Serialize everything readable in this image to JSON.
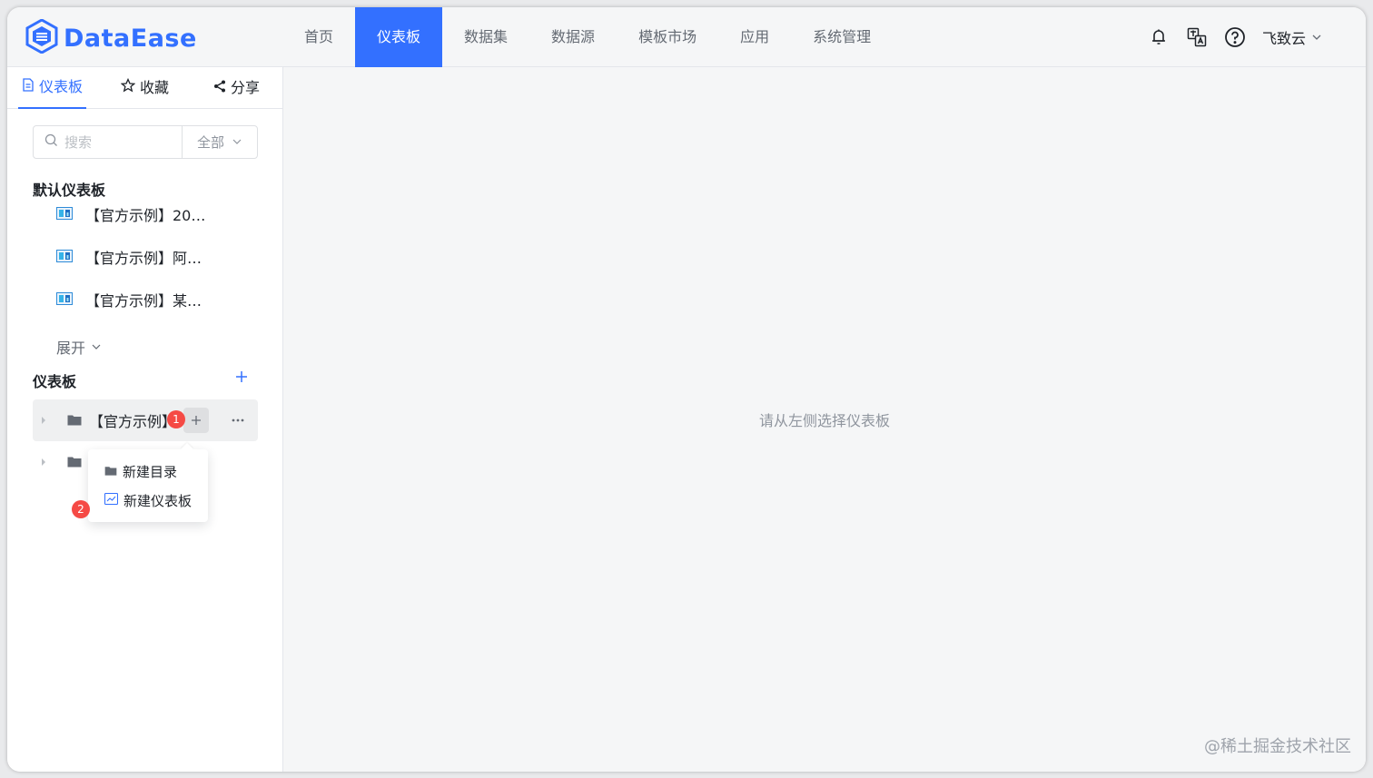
{
  "app": {
    "logo_text": "DataEase",
    "brand_color": "#3370ff"
  },
  "nav": {
    "items": [
      "首页",
      "仪表板",
      "数据集",
      "数据源",
      "模板市场",
      "应用",
      "系统管理"
    ],
    "active_index": 1
  },
  "header_right": {
    "user_name": "飞致云",
    "icons": [
      "bell-icon",
      "translate-icon",
      "help-icon"
    ]
  },
  "sidebar": {
    "tabs": [
      {
        "label": "仪表板",
        "icon": "document-icon",
        "active": true
      },
      {
        "label": "收藏",
        "icon": "star-icon",
        "active": false
      },
      {
        "label": "分享",
        "icon": "share-icon",
        "active": false
      }
    ],
    "search": {
      "placeholder": "搜索",
      "filter_label": "全部"
    },
    "default_section": {
      "title": "默认仪表板",
      "items": [
        "【官方示例】20…",
        "【官方示例】阿…",
        "【官方示例】某…"
      ],
      "expand_label": "展开"
    },
    "dashboard_section": {
      "title": "仪表板",
      "folders": [
        "【官方示例】",
        ""
      ]
    },
    "badges": {
      "one": "1",
      "two": "2"
    },
    "popup_menu": {
      "items": [
        "新建目录",
        "新建仪表板"
      ]
    }
  },
  "main": {
    "empty_tip": "请从左侧选择仪表板"
  },
  "watermark": "@稀土掘金技术社区"
}
